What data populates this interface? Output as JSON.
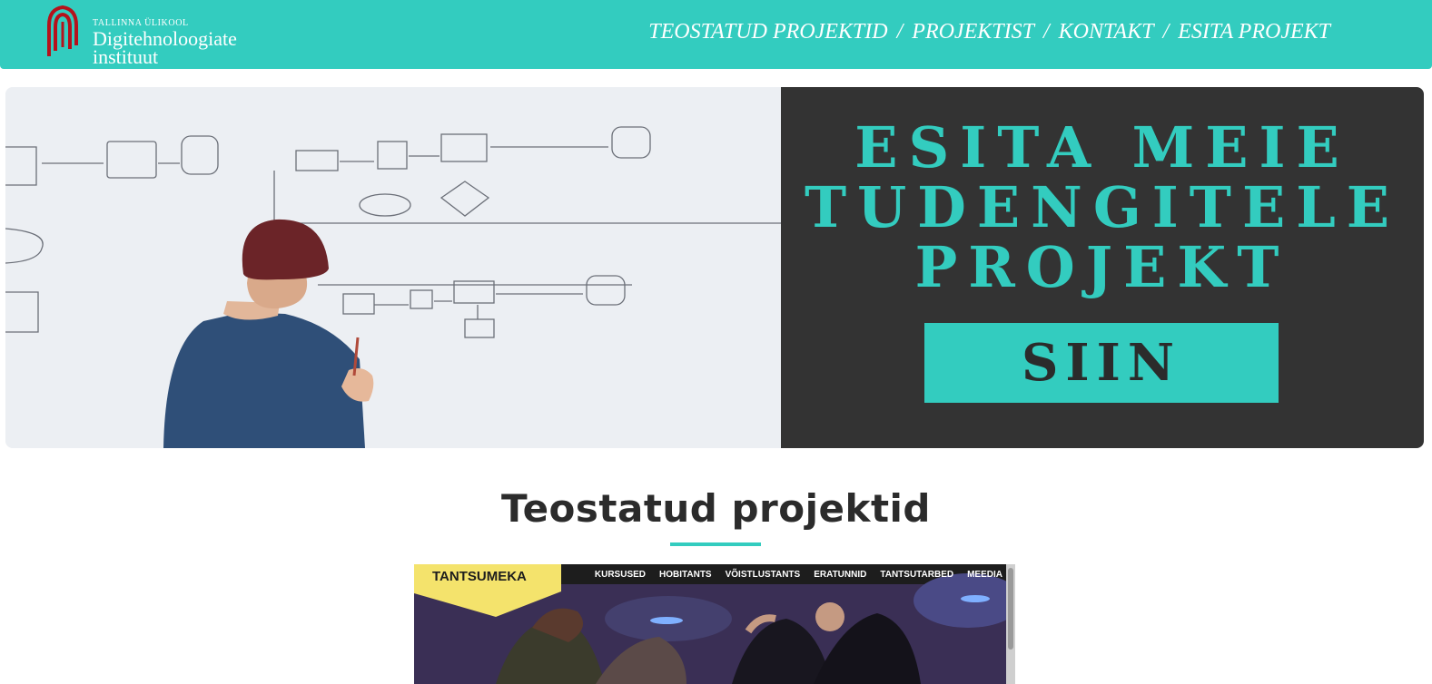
{
  "header": {
    "logo": {
      "small_text": "TALLINNA ÜLIKOOL",
      "line1": "Digitehnoloogiate",
      "line2": "instituut"
    },
    "nav": [
      {
        "label": "TEOSTATUD PROJEKTID"
      },
      {
        "label": "PROJEKTIST"
      },
      {
        "label": "KONTAKT"
      },
      {
        "label": "ESITA PROJEKT"
      }
    ],
    "separator": "/"
  },
  "hero": {
    "headline_line1": "ESITA MEIE",
    "headline_line2": "TUDENGITELE",
    "headline_line3": "PROJEKT",
    "button_label": "SIIN"
  },
  "section": {
    "title": "Teostatud projektid"
  },
  "project_preview": {
    "brand": "TANTSUMEKA",
    "nav": [
      "KURSUSED",
      "HOBITANTS",
      "VÕISTLUSTANTS",
      "ERATUNNID",
      "TANTSUTARBED",
      "MEEDIA"
    ]
  },
  "colors": {
    "accent": "#33ccbf",
    "dark": "#333333",
    "logo_red": "#b5121b"
  }
}
